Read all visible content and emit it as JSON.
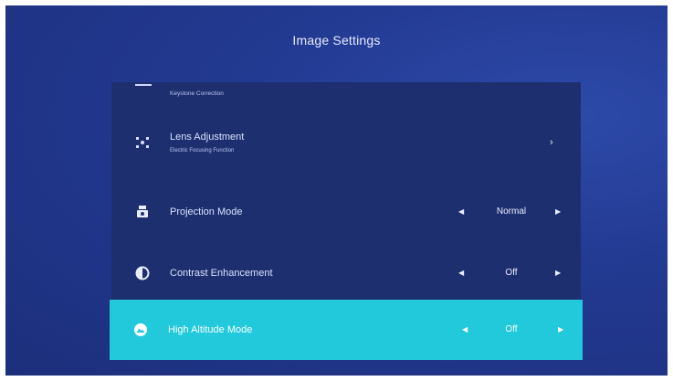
{
  "header": {
    "title": "Image Settings"
  },
  "menu": {
    "items": [
      {
        "label": "",
        "sub": "Keystone Correction",
        "icon": "keystone-icon"
      },
      {
        "label": "Lens Adjustment",
        "sub": "Electric Focusing Function",
        "icon": "lens-adjust-icon",
        "nav": "›"
      },
      {
        "label": "Projection Mode",
        "value": "Normal",
        "icon": "projection-icon"
      },
      {
        "label": "Contrast Enhancement",
        "value": "Off",
        "icon": "contrast-icon"
      },
      {
        "label": "High Altitude Mode",
        "value": "Off",
        "icon": "altitude-icon",
        "selected": true
      }
    ]
  },
  "colors": {
    "background": "#1c2f7c",
    "panel": "#1e2f6f",
    "accent": "#21c9db"
  }
}
